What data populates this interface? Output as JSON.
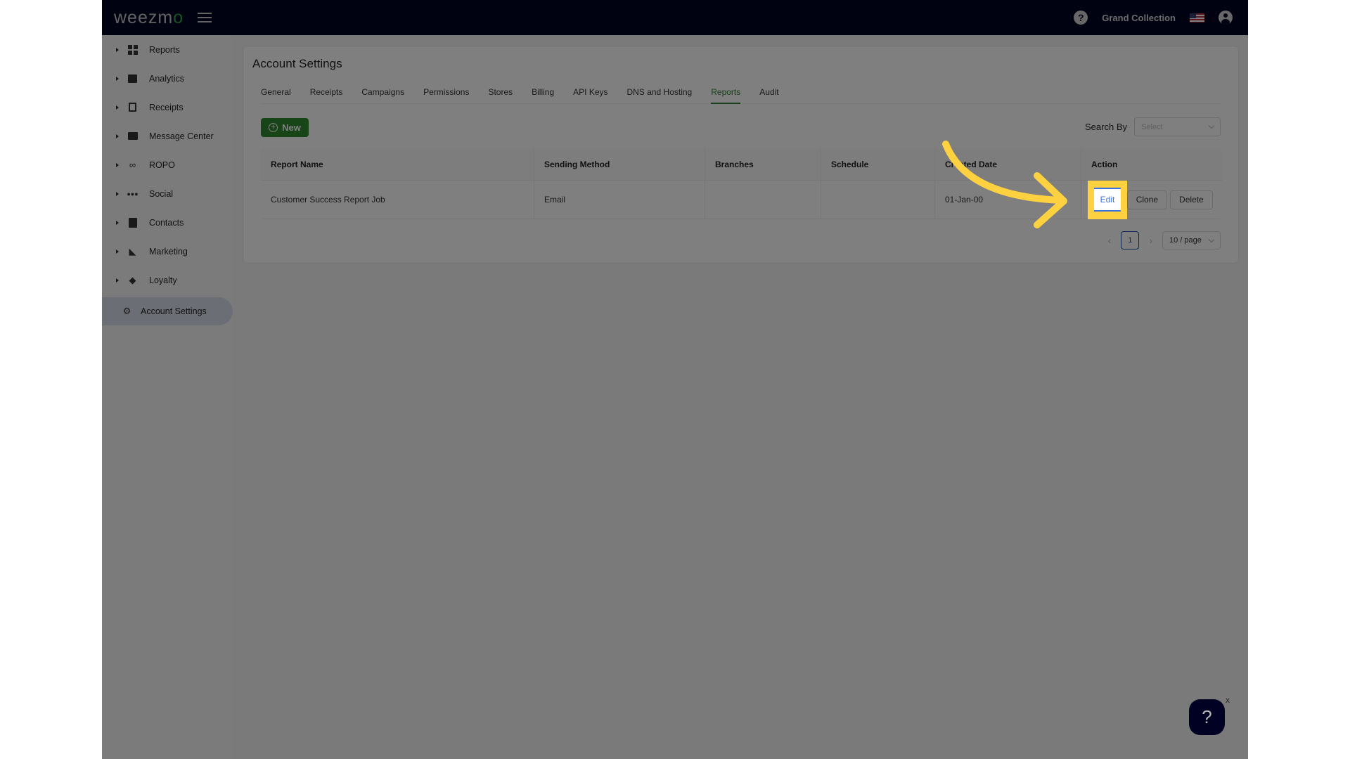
{
  "topbar": {
    "logo": "weezm",
    "logo_accent": "o",
    "store_name": "Grand Collection",
    "help_icon": "?",
    "flag": "us-flag",
    "user": "user-icon"
  },
  "sidebar": {
    "items": [
      {
        "label": "Reports",
        "icon": "dashboard-grid-icon"
      },
      {
        "label": "Analytics",
        "icon": "chart-icon"
      },
      {
        "label": "Receipts",
        "icon": "receipt-icon"
      },
      {
        "label": "Message Center",
        "icon": "message-icon"
      },
      {
        "label": "ROPO",
        "icon": "infinity-icon"
      },
      {
        "label": "Social",
        "icon": "people-icon"
      },
      {
        "label": "Contacts",
        "icon": "contact-card-icon"
      },
      {
        "label": "Marketing",
        "icon": "party-popper-icon"
      },
      {
        "label": "Loyalty",
        "icon": "tag-heart-icon"
      }
    ],
    "active": {
      "label": "Account Settings",
      "icon": "gear-icon"
    }
  },
  "page": {
    "title": "Account Settings",
    "tabs": [
      {
        "label": "General"
      },
      {
        "label": "Receipts"
      },
      {
        "label": "Campaigns"
      },
      {
        "label": "Permissions"
      },
      {
        "label": "Stores"
      },
      {
        "label": "Billing"
      },
      {
        "label": "API Keys"
      },
      {
        "label": "DNS and Hosting"
      },
      {
        "label": "Reports",
        "active": true
      },
      {
        "label": "Audit"
      }
    ],
    "new_button": "New",
    "search_by_label": "Search By",
    "search_select_placeholder": "Select"
  },
  "table": {
    "columns": [
      "Report Name",
      "Sending Method",
      "Branches",
      "Schedule",
      "Created Date",
      "Action"
    ],
    "rows": [
      {
        "report_name": "Customer Success Report Job",
        "sending_method": "Email",
        "branches": "",
        "schedule": "",
        "created_date": "01-Jan-00",
        "actions": [
          "Edit",
          "Clone",
          "Delete"
        ]
      }
    ]
  },
  "pagination": {
    "current_page": "1",
    "page_size": "10 / page",
    "prev": "‹",
    "next": "›"
  },
  "help_widget": {
    "icon": "?",
    "close": "x"
  },
  "colors": {
    "topbar": "#010223",
    "accent_green": "#2e8b2e",
    "highlight": "#fdd13f",
    "link_blue": "#3d6fe0"
  }
}
